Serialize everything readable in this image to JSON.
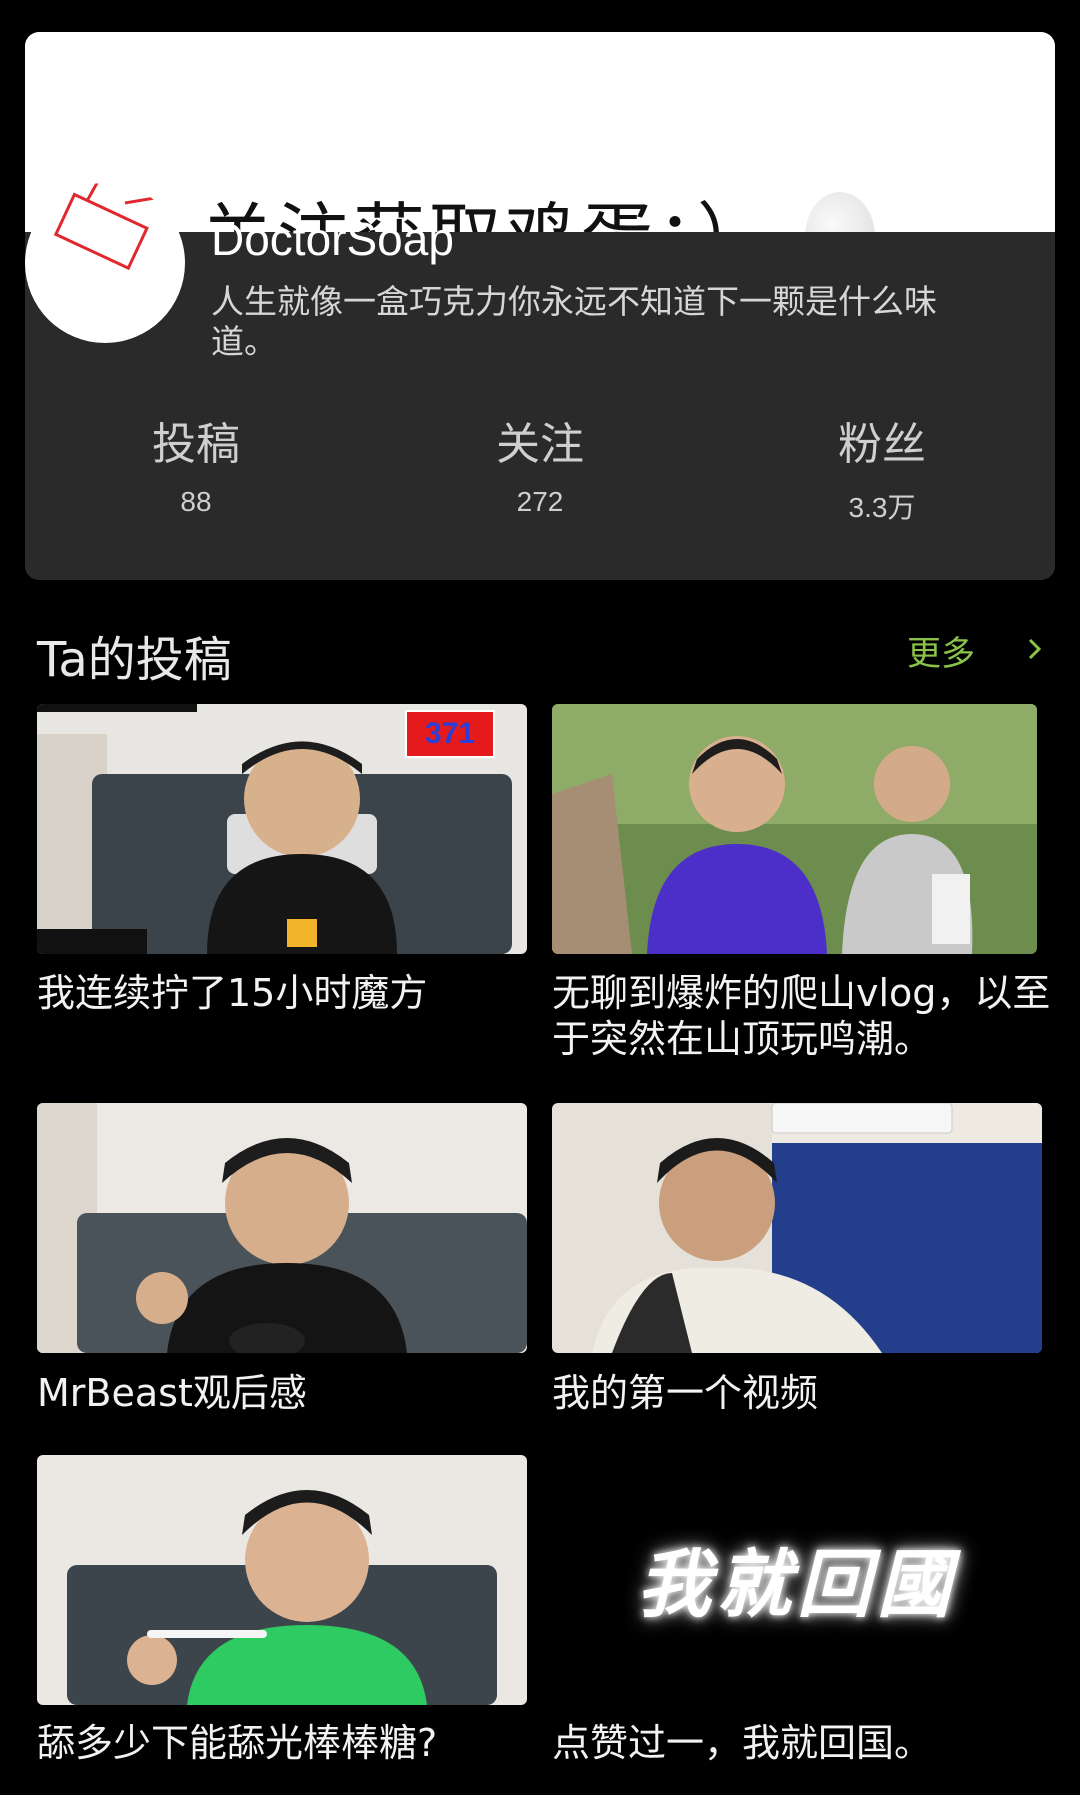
{
  "profile": {
    "banner_text": "关注获取鸡蛋：）",
    "username": "DoctorSoap",
    "bio": "人生就像一盒巧克力你永远不知道下一颗是什么味道。"
  },
  "stats": [
    {
      "label": "投稿",
      "value": "88"
    },
    {
      "label": "关注",
      "value": "272"
    },
    {
      "label": "粉丝",
      "value": "3.3万"
    }
  ],
  "section": {
    "title": "Ta的投稿",
    "more_label": "更多"
  },
  "videos": [
    {
      "title": "我连续拧了15小时魔方",
      "overlay_badge": "371"
    },
    {
      "title": "无聊到爆炸的爬山vlog，以至于突然在山顶玩鸣潮。"
    },
    {
      "title": "MrBeast观后感"
    },
    {
      "title": "我的第一个视频"
    },
    {
      "title": "舔多少下能舔光棒棒糖?"
    },
    {
      "title": "点赞过一，我就回国。",
      "cover_text": "我就回國"
    }
  ],
  "colors": {
    "accent": "#8bc34a",
    "card_bg": "#2a2a2a",
    "page_bg": "#000000"
  }
}
